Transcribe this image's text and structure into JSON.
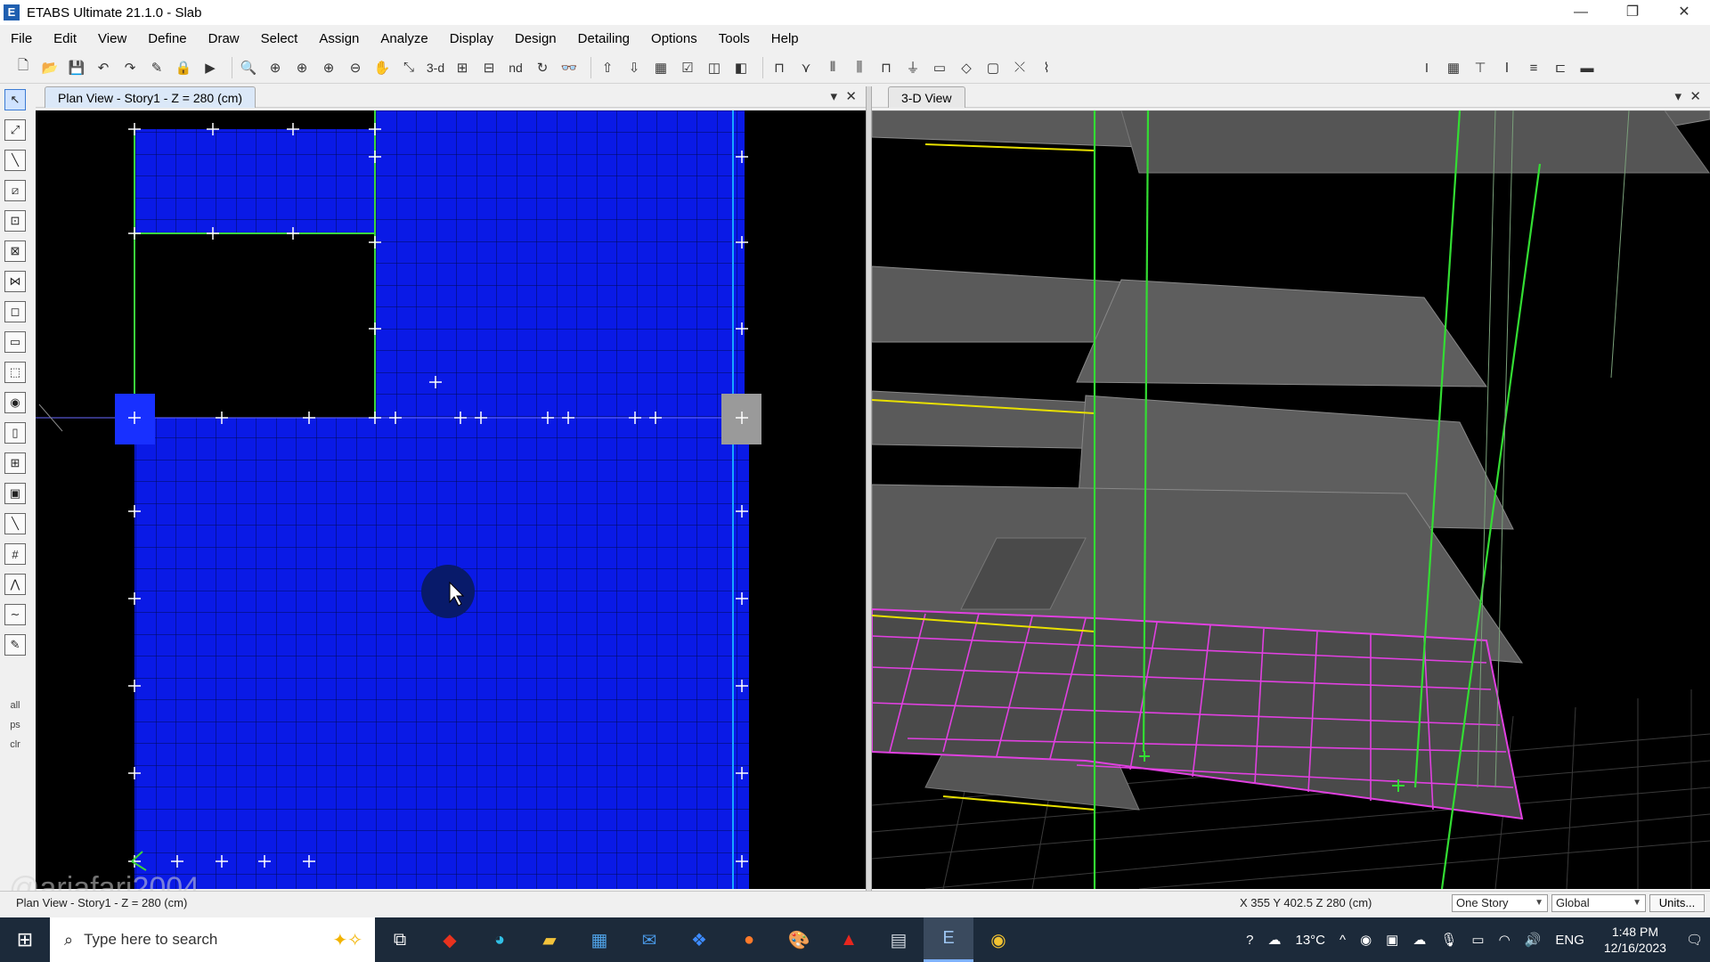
{
  "window": {
    "title": "ETABS Ultimate 21.1.0 - Slab",
    "app_letter": "E",
    "controls": [
      "—",
      "❐",
      "✕"
    ]
  },
  "menu": [
    "File",
    "Edit",
    "View",
    "Define",
    "Draw",
    "Select",
    "Assign",
    "Analyze",
    "Display",
    "Design",
    "Detailing",
    "Options",
    "Tools",
    "Help"
  ],
  "toolbar": {
    "text_buttons": {
      "three_d": "3-d",
      "nd": "nd"
    }
  },
  "plan_view": {
    "tab_label": "Plan View - Story1 - Z = 280 (cm)",
    "colors": {
      "slab": "#0a1ae6",
      "grid": "#18a8ff",
      "beam": "#3cd63c",
      "point": "#ffffff"
    }
  },
  "view_3d": {
    "tab_label": "3-D View",
    "colors": {
      "slab": "#5a5a5a",
      "column": "#33dd33",
      "mesh": "#e040e0",
      "beam": "#e8e000"
    }
  },
  "left_tools": {
    "labels": [
      "all",
      "ps",
      "clr"
    ]
  },
  "watermark": "@ariafari2004",
  "status": {
    "left": "Plan View - Story1 - Z = 280 (cm)",
    "coords": "X 355  Y 402.5  Z 280 (cm)",
    "story_select": "One Story",
    "coord_select": "Global",
    "units_button": "Units..."
  },
  "taskbar": {
    "search_placeholder": "Type here to search",
    "weather": "13°C",
    "language": "ENG",
    "time": "1:48 PM",
    "date": "12/16/2023"
  }
}
